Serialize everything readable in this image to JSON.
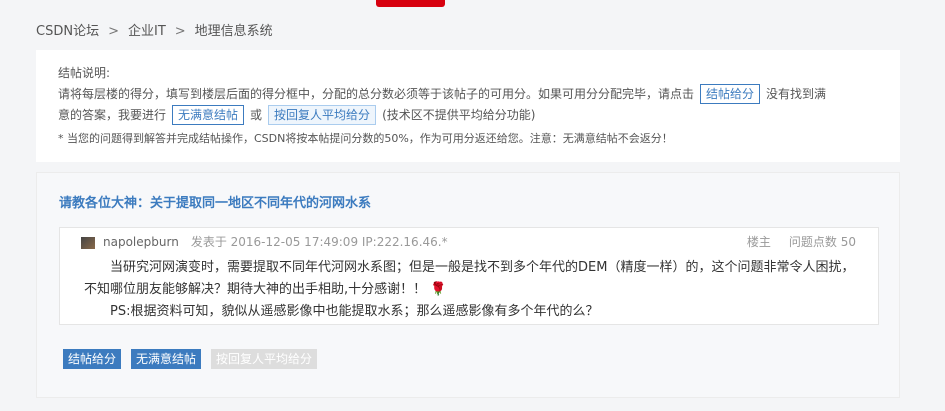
{
  "breadcrumb": {
    "items": [
      "CSDN论坛",
      "企业IT",
      "地理信息系统"
    ],
    "separator": ">"
  },
  "notice": {
    "heading": "结帖说明:",
    "line1_before": "请将每层楼的得分，填写到楼层后面的得分框中，分配的总分数必须等于该帖子的可用分。如果可用分分配完毕，请点击",
    "settle_button": "结帖给分",
    "line1_after": "没有找到满",
    "line2_before": "意的答案，我要进行",
    "no_satisfy_button": "无满意结帖",
    "or": "或",
    "average_button": "按回复人平均给分",
    "line2_after": "(技术区不提供平均给分功能)",
    "warning": "* 当您的问题得到解答并完成结帖操作，CSDN将按本帖提问分数的50%，作为可用分返还给您。注意：无满意结帖不会返分！"
  },
  "post": {
    "title": "请教各位大神：关于提取同一地区不同年代的河网水系",
    "username": "napolepburn",
    "posted": "发表于 2016-12-05 17:49:09 IP:222.16.46.*",
    "floor": "楼主",
    "points": "问题点数 50",
    "paragraph1": "当研究河网演变时，需要提取不同年代河网水系图；但是一般是找不到多个年代的DEM（精度一样）的，这个问题非常令人困扰，不知哪位朋友能够解决？期待大神的出手相助,十分感谢！！",
    "rose": "🌹",
    "paragraph2": "PS:根据资料可知，貌似从遥感影像中也能提取水系；那么遥感影像有多个年代的么？"
  },
  "actions": {
    "settle": "结帖给分",
    "no_satisfy": "无满意结帖",
    "average": "按回复人平均给分"
  },
  "colors": {
    "accent": "#3c7bbf",
    "brand_red": "#d7000f"
  }
}
